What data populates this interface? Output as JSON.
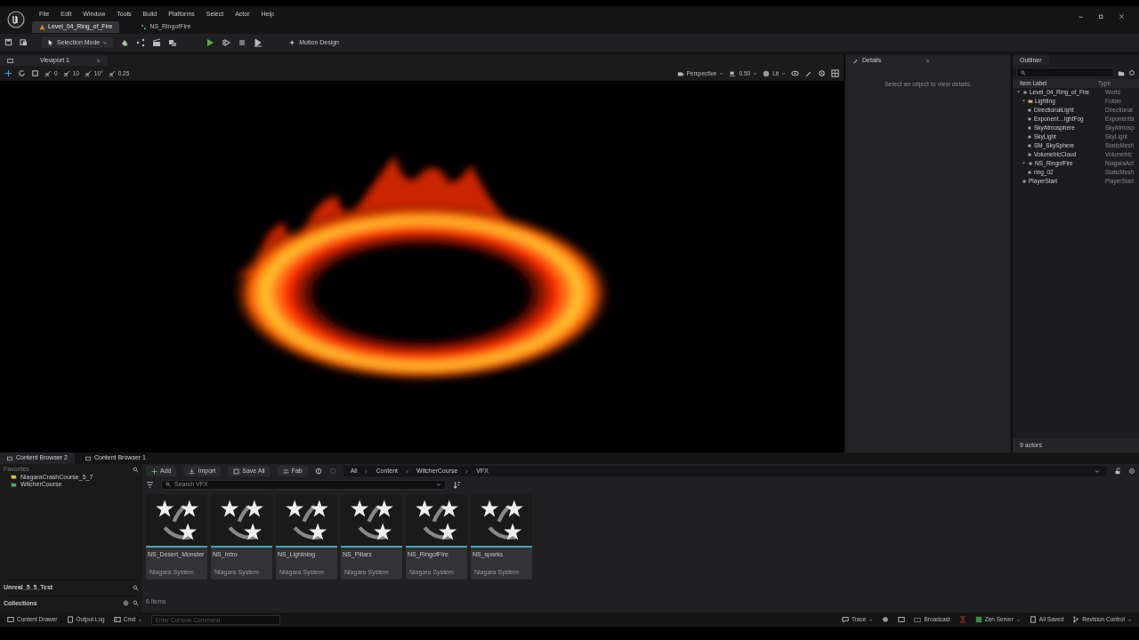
{
  "menu": [
    "File",
    "Edit",
    "Window",
    "Tools",
    "Build",
    "Platforms",
    "Select",
    "Actor",
    "Help"
  ],
  "document_tabs": [
    {
      "label": "Level_04_Ring_of_Fire",
      "selected": true
    },
    {
      "label": "NS_RingofFire",
      "selected": false
    }
  ],
  "toolbar": {
    "mode": "Selection Mode",
    "motion_design": "Motion Design"
  },
  "viewport": {
    "tab": "Viewport 1",
    "snap_values": [
      "0",
      "10",
      "10°",
      "0.25"
    ],
    "view_mode": "Perspective",
    "camera_speed": "0.50",
    "lighting": "Lit"
  },
  "details": {
    "tab": "Details",
    "message": "Select an object to view details."
  },
  "outliner": {
    "tab": "Outliner",
    "columns": [
      "Item Label",
      "Type"
    ],
    "footer": "9 actors",
    "items": [
      {
        "label": "Level_04_Ring_of_Fire",
        "type": "World",
        "expanded": true,
        "children": [
          {
            "label": "Lighting",
            "type": "Folder",
            "expanded": true,
            "children": [
              {
                "label": "DirectionalLight",
                "type": "Directional"
              },
              {
                "label": "Exponent…ightFog",
                "type": "Exponentia"
              },
              {
                "label": "SkyAtmosphere",
                "type": "SkyAtmosp"
              },
              {
                "label": "SkyLight",
                "type": "SkyLight"
              },
              {
                "label": "SM_SkySphere",
                "type": "StaticMesh"
              },
              {
                "label": "VolumetricCloud",
                "type": "Volumetric"
              }
            ]
          },
          {
            "label": "NS_RingofFire",
            "type": "NiagaraAct",
            "expanded": true,
            "children": [
              {
                "label": "ring_02",
                "type": "StaticMesh"
              }
            ]
          },
          {
            "label": "PlayerStart",
            "type": "PlayerStart"
          }
        ]
      }
    ]
  },
  "content_browser": {
    "tabs": [
      {
        "label": "Content Browser 2",
        "selected": true
      },
      {
        "label": "Content Browser 1",
        "selected": false
      }
    ],
    "favorites": "Favorites",
    "folders": [
      {
        "label": "NiagaraCrashCourse_5_7",
        "color": "#e0c23a"
      },
      {
        "label": "WitcherCourse",
        "color": "#4caf50"
      }
    ],
    "project": "Unreal_5_5_Test",
    "collections": "Collections",
    "buttons": [
      "Add",
      "Import",
      "Save All",
      "Fab"
    ],
    "breadcrumbs": [
      "All",
      "Content",
      "WitcherCourse",
      "VFX"
    ],
    "search": {
      "placeholder": "Search VFX"
    },
    "assets": [
      {
        "name": "NS_Desert_Monster",
        "type": "Niagara System"
      },
      {
        "name": "NS_Intro",
        "type": "Niagara System"
      },
      {
        "name": "NS_Lightning",
        "type": "Niagara System"
      },
      {
        "name": "NS_Pillars",
        "type": "Niagara System"
      },
      {
        "name": "NS_RingofFire",
        "type": "Niagara System"
      },
      {
        "name": "NS_sparks",
        "type": "Niagara System"
      }
    ],
    "count": "6 items"
  },
  "status_bar": {
    "left": [
      "Content Drawer",
      "Output Log",
      "Cmd"
    ],
    "console": {
      "placeholder": "Enter Console Command"
    },
    "right": [
      "Trace",
      "Broadcast",
      "Zen Server",
      "All Saved",
      "Revision Control"
    ]
  }
}
